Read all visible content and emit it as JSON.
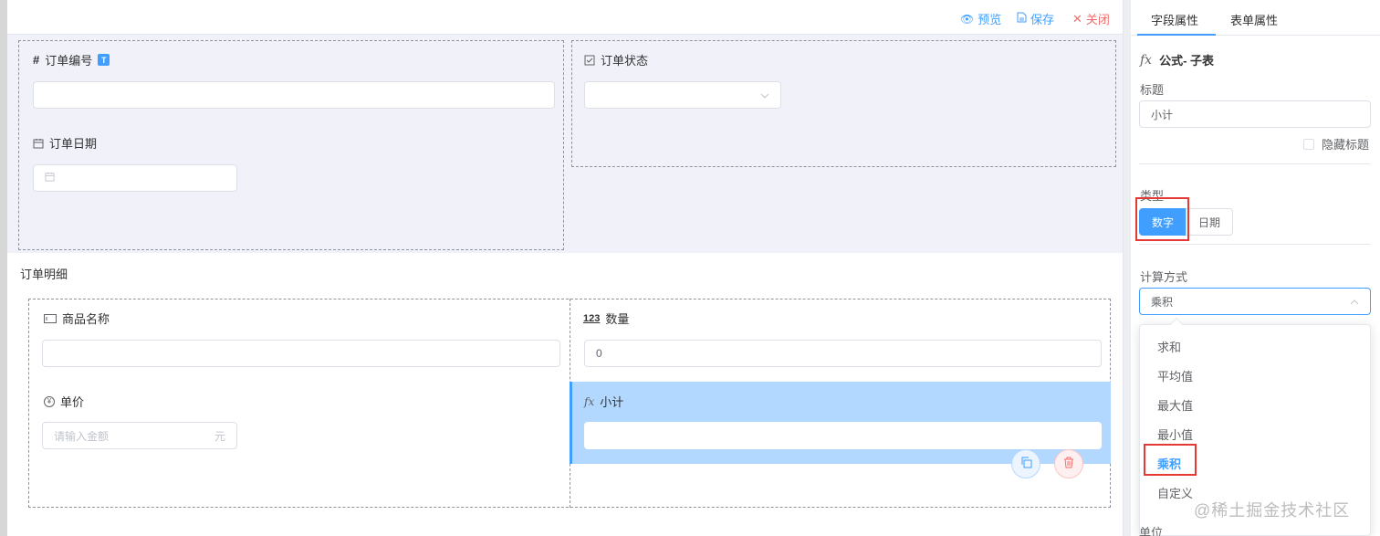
{
  "toolbar": {
    "preview": "预览",
    "save": "保存",
    "close": "关闭"
  },
  "form": {
    "order_no": {
      "label": "订单编号",
      "badge": "T"
    },
    "order_status": {
      "label": "订单状态"
    },
    "order_date": {
      "label": "订单日期"
    },
    "detail_title": "订单明细",
    "product_name": {
      "label": "商品名称"
    },
    "quantity": {
      "label": "数量",
      "value": "0"
    },
    "unit_price": {
      "label": "单价",
      "placeholder": "请输入金额",
      "suffix": "元"
    },
    "subtotal": {
      "label": "小计"
    }
  },
  "panel": {
    "tabs": [
      "字段属性",
      "表单属性"
    ],
    "field_title": "公式- 子表",
    "title_label": "标题",
    "title_value": "小计",
    "hide_title": "隐藏标题",
    "type_label": "类型",
    "type_options": [
      "数字",
      "日期"
    ],
    "calc_label": "计算方式",
    "calc_value": "乘积",
    "calc_options": [
      "求和",
      "平均值",
      "最大值",
      "最小值",
      "乘积",
      "自定义"
    ],
    "unit_label": "单位"
  },
  "watermark": "@稀土掘金技术社区",
  "colors": {
    "accent": "#409eff",
    "danger": "#f56c6c",
    "highlight": "#e53935",
    "selected_bg": "#b3d8ff"
  }
}
